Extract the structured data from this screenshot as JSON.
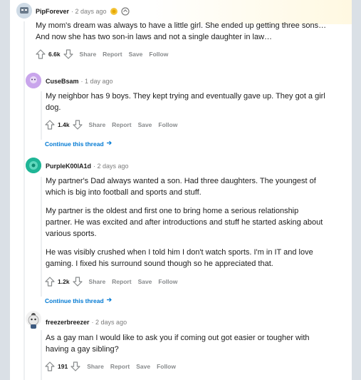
{
  "comments": [
    {
      "username": "PipForever",
      "time": "· 2 days ago",
      "paragraphs": [
        "My mom's dream was always to have a little girl. She ended up getting three sons… And now she has two son-in laws and not a single daughter in law…"
      ],
      "score": "6.6k",
      "actions": [
        "Share",
        "Report",
        "Save",
        "Follow"
      ],
      "awards": [
        "gold-award-icon",
        "helpful-award-icon"
      ]
    },
    {
      "username": "CuseBsam",
      "time": "· 1 day ago",
      "paragraphs": [
        "My neighbor has 9 boys. They kept trying and eventually gave up. They got a girl dog."
      ],
      "score": "1.4k",
      "actions": [
        "Share",
        "Report",
        "Save",
        "Follow"
      ]
    },
    {
      "username": "PurpleK00lA1d",
      "time": "· 2 days ago",
      "paragraphs": [
        "My partner's Dad always wanted a son. Had three daughters. The youngest of which is big into football and sports and stuff.",
        "My partner is the oldest and first one to bring home a serious relationship partner. He was excited and after introductions and stuff he started asking about various sports.",
        "He was visibly crushed when I told him I don't watch sports. I'm in IT and love gaming. I fixed his surround sound though so he appreciated that."
      ],
      "score": "1.2k",
      "actions": [
        "Share",
        "Report",
        "Save",
        "Follow"
      ]
    },
    {
      "username": "freezerbreezer",
      "time": "· 2 days ago",
      "paragraphs": [
        "As a gay man I would like to ask you if coming out got easier or tougher with having a gay sibling?"
      ],
      "score": "191",
      "actions": [
        "Share",
        "Report",
        "Save",
        "Follow"
      ]
    }
  ],
  "continue_label": "Continue this thread",
  "colors": {
    "link": "#0079d3",
    "muted": "#878a8c",
    "text": "#1c1c1c",
    "thread_line": "#edeff1",
    "background": "#dae0e6"
  }
}
